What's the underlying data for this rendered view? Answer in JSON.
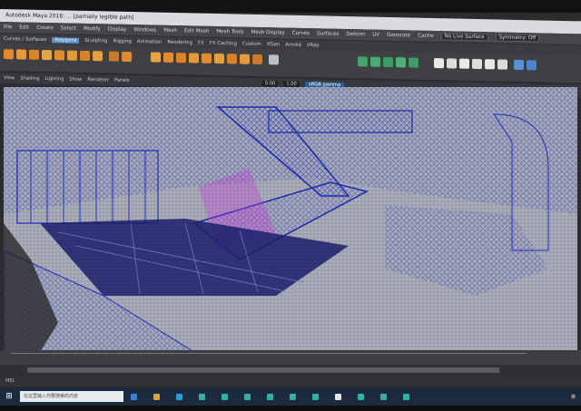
{
  "window": {
    "title": "Autodesk Maya 2016: ... [partially legible path]"
  },
  "menubar": {
    "items": [
      "File",
      "Edit",
      "Create",
      "Select",
      "Modify",
      "Display",
      "Windows",
      "Mesh",
      "Edit Mesh",
      "Mesh Tools",
      "Mesh Display",
      "Curves",
      "Surfaces",
      "Deform",
      "UV",
      "Generate",
      "Cache"
    ],
    "live_surface": "No Live Surface",
    "symmetry": "Symmetry: Off"
  },
  "shelf_tabs": {
    "items": [
      "Curves / Surfaces",
      "Polygons",
      "Sculpting",
      "Rigging",
      "Animation",
      "Rendering",
      "FX",
      "FX Caching",
      "Custom",
      "XGen",
      "Arnold",
      "VRay"
    ],
    "active_index": 1
  },
  "viewport_toolbar": {
    "menus": [
      "View",
      "Shading",
      "Lighting",
      "Show",
      "Renderer",
      "Panels"
    ],
    "value_a": "0.00",
    "value_b": "1.00",
    "color_space": "sRGB gamma"
  },
  "colors": {
    "window_chrome": "#3e4043",
    "viewport_bg": "#8f9196",
    "wire_blue": "#1f2fb8",
    "selection_magenta": "#c23ad6",
    "taskbar": "#1b2a3d"
  },
  "taskbar": {
    "search_placeholder": "在这里输入你要搜索的内容",
    "tray_text": "英"
  },
  "icons": {
    "start": "windows-start-icon"
  }
}
